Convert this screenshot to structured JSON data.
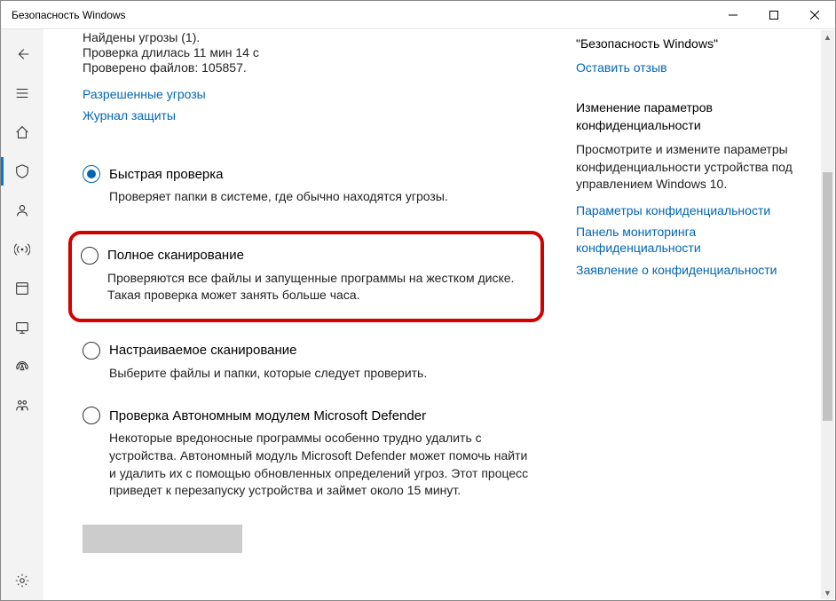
{
  "window": {
    "title": "Безопасность Windows"
  },
  "status": {
    "threats_found": "Найдены угрозы (1).",
    "scan_duration": "Проверка длилась 11 мин 14 с",
    "files_checked": "Проверено файлов: 105857.",
    "link_allowed": "Разрешенные угрозы",
    "link_history": "Журнал защиты"
  },
  "options": [
    {
      "title": "Быстрая проверка",
      "desc": "Проверяет папки в системе, где обычно находятся угрозы.",
      "checked": true,
      "highlight": false
    },
    {
      "title": "Полное сканирование",
      "desc": "Проверяются все файлы и запущенные программы на жестком диске. Такая проверка может занять больше часа.",
      "checked": false,
      "highlight": true
    },
    {
      "title": "Настраиваемое сканирование",
      "desc": "Выберите файлы и папки, которые следует проверить.",
      "checked": false,
      "highlight": false
    },
    {
      "title": "Проверка Автономным модулем Microsoft Defender",
      "desc": "Некоторые вредоносные программы особенно трудно удалить с устройства. Автономный модуль Microsoft Defender может помочь найти и удалить их с помощью обновленных определений угроз. Этот процесс приведет к перезапуску устройства и займет около 15 минут.",
      "checked": false,
      "highlight": false
    }
  ],
  "side": {
    "brand": "\"Безопасность Windows\"",
    "feedback": "Оставить отзыв",
    "privacy_h1": "Изменение параметров",
    "privacy_h2": "конфиденциальности",
    "privacy_text": "Просмотрите и измените параметры конфиденциальности устройства под управлением Windows 10.",
    "links": [
      "Параметры конфиденциальности",
      "Панель мониторинга конфиденциальности",
      "Заявление о конфиденциальности"
    ]
  }
}
